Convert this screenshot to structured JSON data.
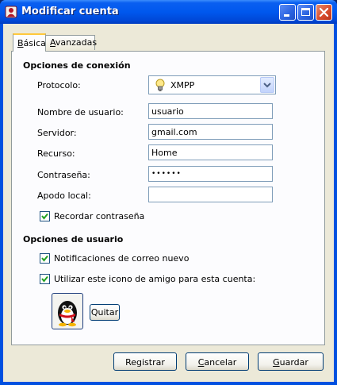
{
  "window": {
    "title": "Modificar cuenta"
  },
  "tabs": [
    {
      "label_u": "B",
      "label_rest": "ásica"
    },
    {
      "label_u": "A",
      "label_rest": "vanzadas"
    }
  ],
  "connection": {
    "title": "Opciones de conexión",
    "protocol_label": "Protocolo:",
    "protocol_value": "XMPP",
    "username_label": "Nombre de usuario:",
    "username_value": "usuario",
    "server_label": "Servidor:",
    "server_value": "gmail.com",
    "resource_label": "Recurso:",
    "resource_value": "Home",
    "password_label": "Contraseña:",
    "password_value": "••••••",
    "alias_label": "Apodo local:",
    "alias_value": "",
    "remember_label": "Recordar contraseña"
  },
  "user_options": {
    "title": "Opciones de usuario",
    "mail_label": "Notificaciones de correo nuevo",
    "buddy_icon_label": "Utilizar este icono de amigo para esta cuenta:",
    "remove_label": "Quitar"
  },
  "buttons": {
    "register": "Registrar",
    "cancel_u": "C",
    "cancel_rest": "ancelar",
    "save_u": "G",
    "save_rest": "uardar"
  },
  "icons": {
    "app": "app-account-icon",
    "minimize": "minimize-icon",
    "maximize": "maximize-icon",
    "close": "close-icon",
    "protocol": "lightbulb-icon",
    "avatar": "penguin-icon"
  }
}
